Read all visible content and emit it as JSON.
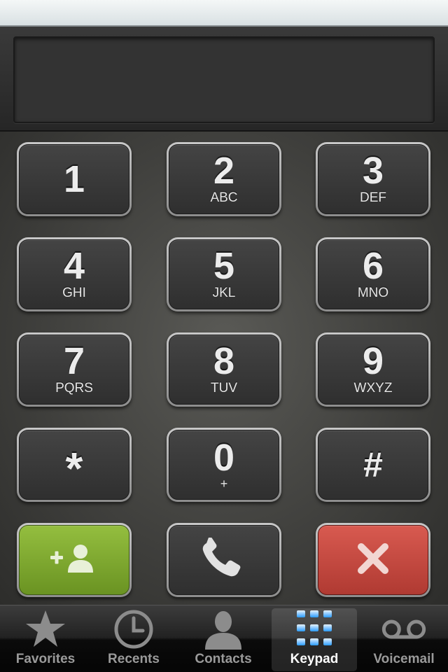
{
  "display": {
    "number": ""
  },
  "keys": [
    {
      "digit": "1",
      "letters": ""
    },
    {
      "digit": "2",
      "letters": "ABC"
    },
    {
      "digit": "3",
      "letters": "DEF"
    },
    {
      "digit": "4",
      "letters": "GHI"
    },
    {
      "digit": "5",
      "letters": "JKL"
    },
    {
      "digit": "6",
      "letters": "MNO"
    },
    {
      "digit": "7",
      "letters": "PQRS"
    },
    {
      "digit": "8",
      "letters": "TUV"
    },
    {
      "digit": "9",
      "letters": "WXYZ"
    },
    {
      "digit": "*",
      "letters": ""
    },
    {
      "digit": "0",
      "letters": "+"
    },
    {
      "digit": "#",
      "letters": ""
    }
  ],
  "actions": {
    "add_contact_icon": "add-contact-icon",
    "call_icon": "phone-handset-icon",
    "delete_icon": "close-icon",
    "add_color": "#7fab30",
    "delete_color": "#c44840"
  },
  "tabs": [
    {
      "label": "Favorites",
      "icon": "star-icon",
      "active": false
    },
    {
      "label": "Recents",
      "icon": "clock-icon",
      "active": false
    },
    {
      "label": "Contacts",
      "icon": "person-icon",
      "active": false
    },
    {
      "label": "Keypad",
      "icon": "keypad-icon",
      "active": true
    },
    {
      "label": "Voicemail",
      "icon": "voicemail-icon",
      "active": false
    }
  ]
}
